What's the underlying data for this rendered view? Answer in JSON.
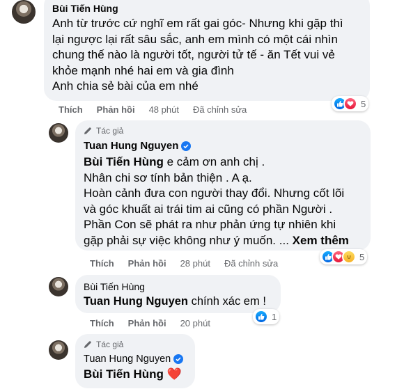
{
  "comments": [
    {
      "author": "Bùi Tiến Hùng",
      "lines": [
        "Anh từ trước cứ nghĩ em rất gai góc- Nhưng khi gặp thì",
        "lại ngược lại rất sâu sắc, anh em mình có một cái nhìn",
        "chung thế nào là người tốt, người tử tế - ăn Tết vui vẻ",
        "khỏe mạnh nhé hai em và gia đình",
        "Anh chia sẻ bài của em nhé"
      ],
      "actions": {
        "like": "Thích",
        "reply": "Phản hồi",
        "time": "48 phút",
        "edited": "Đã chỉnh sửa"
      },
      "reaction_count": "5"
    },
    {
      "author_badge": "Tác giả",
      "author": "Tuan Hung Nguyen",
      "mention": "Bùi Tiến Hùng",
      "first_line_rest": " e cảm ơn anh chị .",
      "lines": [
        "Nhân chi sơ tính bản thiện . A ạ.",
        "Hoàn cảnh đưa con người thay đổi. Nhưng cốt lõi",
        "và góc khuất ai trái tim ai cũng có phần Người .",
        "Phần Con sẽ phát ra như phản ứng tự nhiên khi"
      ],
      "last_line": "gặp phải sự việc không như ý muốn. ... ",
      "see_more": "Xem thêm",
      "actions": {
        "like": "Thích",
        "reply": "Phản hồi",
        "time": "28 phút",
        "edited": "Đã chỉnh sửa"
      },
      "reaction_count": "5"
    },
    {
      "author": "Bùi Tiến Hùng",
      "mention": "Tuan Hung Nguyen",
      "rest": " chính xác em !",
      "actions": {
        "like": "Thích",
        "reply": "Phản hồi",
        "time": "20 phút"
      },
      "reaction_count": "1"
    },
    {
      "author_badge": "Tác giả",
      "author": "Tuan Hung Nguyen",
      "mention": "Bùi Tiến Hùng",
      "heart": "❤️"
    }
  ],
  "colors": {
    "bubble": "#f0f2f5",
    "verified": "#1877f2",
    "meta": "#65676b"
  }
}
